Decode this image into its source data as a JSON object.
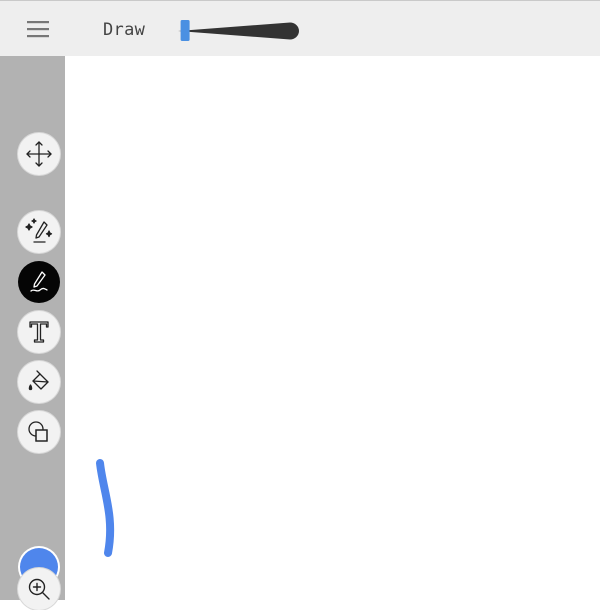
{
  "app": {
    "title": "Draw"
  },
  "toolbar": {
    "menu_icon": "hamburger-menu-icon",
    "brush_size": {
      "value_fraction": 0.06
    }
  },
  "tools": [
    {
      "id": "move",
      "icon": "move-arrows-icon",
      "active": false
    },
    {
      "id": "magic-pen",
      "icon": "magic-pen-icon",
      "active": false
    },
    {
      "id": "pen",
      "icon": "pen-icon",
      "active": true
    },
    {
      "id": "text",
      "icon": "text-icon",
      "active": false
    },
    {
      "id": "fill",
      "icon": "paint-bucket-icon",
      "active": false
    },
    {
      "id": "shapes",
      "icon": "shapes-icon",
      "active": false
    },
    {
      "id": "zoom",
      "icon": "zoom-in-icon",
      "active": false
    }
  ],
  "color": {
    "current": "#4f86ec"
  },
  "colors": {
    "topbar": "#eeeeee",
    "sidebar": "#b2b2b2",
    "slider_thumb": "#4a90e2",
    "slider_track": "#333333"
  },
  "canvas": {
    "strokes": [
      {
        "color": "#4f86ec"
      }
    ]
  }
}
